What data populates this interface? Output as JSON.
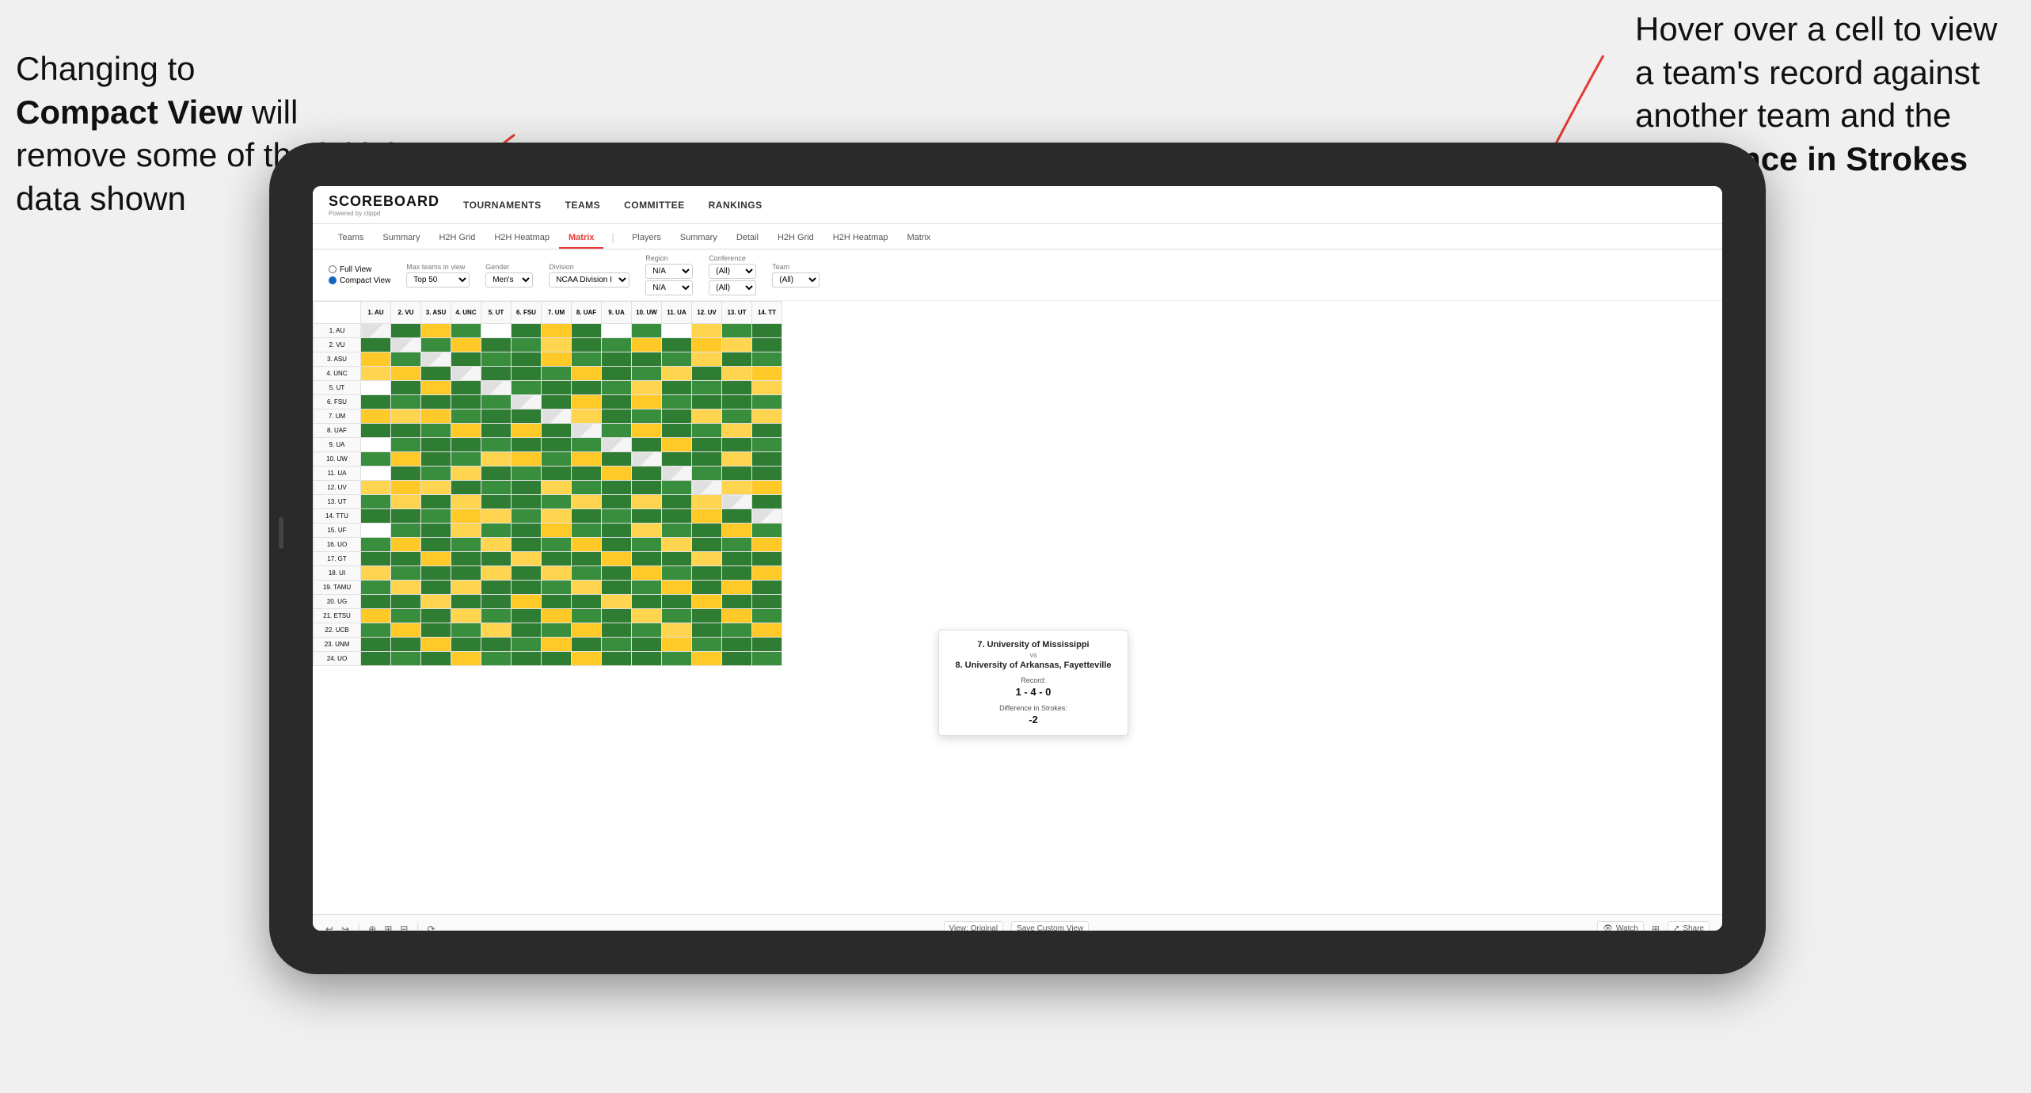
{
  "annotations": {
    "left_title": "Changing to",
    "left_bold": "Compact View",
    "left_text": " will remove some of the initial data shown",
    "right_text": "Hover over a cell to view a team's record against another team and the ",
    "right_bold": "Difference in Strokes"
  },
  "app": {
    "logo": "SCOREBOARD",
    "logo_sub": "Powered by clippd",
    "nav": [
      "TOURNAMENTS",
      "TEAMS",
      "COMMITTEE",
      "RANKINGS"
    ]
  },
  "sub_nav": {
    "groups": [
      {
        "label": "Teams"
      },
      {
        "label": "Summary"
      },
      {
        "label": "H2H Grid"
      },
      {
        "label": "H2H Heatmap"
      },
      {
        "label": "Matrix",
        "active": true
      }
    ],
    "groups2": [
      {
        "label": "Players"
      },
      {
        "label": "Summary"
      },
      {
        "label": "Detail"
      },
      {
        "label": "H2H Grid"
      },
      {
        "label": "H2H Heatmap"
      },
      {
        "label": "Matrix"
      }
    ]
  },
  "filters": {
    "view_full": "Full View",
    "view_compact": "Compact View",
    "max_teams_label": "Max teams in view",
    "max_teams_value": "Top 50",
    "gender_label": "Gender",
    "gender_value": "Men's",
    "division_label": "Division",
    "division_value": "NCAA Division I",
    "region_label": "Region",
    "region_value": "N/A",
    "region2_value": "N/A",
    "conference_label": "Conference",
    "conference_value": "(All)",
    "conference2_value": "(All)",
    "team_label": "Team",
    "team_value": "(All)"
  },
  "col_headers": [
    "1. AU",
    "2. VU",
    "3. ASU",
    "4. UNC",
    "5. UT",
    "6. FSU",
    "7. UM",
    "8. UAF",
    "9. UA",
    "10. UW",
    "11. UA",
    "12. UV",
    "13. UT",
    "14. TT"
  ],
  "row_headers": [
    "1. AU",
    "2. VU",
    "3. ASU",
    "4. UNC",
    "5. UT",
    "6. FSU",
    "7. UM",
    "8. UAF",
    "9. UA",
    "10. UW",
    "11. UA",
    "12. UV",
    "13. UT",
    "14. TTU",
    "15. UF",
    "16. UO",
    "17. GT",
    "18. UI",
    "19. TAMU",
    "20. UG",
    "21. ETSU",
    "22. UCB",
    "23. UNM",
    "24. UO"
  ],
  "tooltip": {
    "team1": "7. University of Mississippi",
    "vs": "vs",
    "team2": "8. University of Arkansas, Fayetteville",
    "record_label": "Record:",
    "record": "1 - 4 - 0",
    "diff_label": "Difference in Strokes:",
    "diff": "-2"
  },
  "toolbar": {
    "view_original": "View: Original",
    "save_custom": "Save Custom View",
    "watch": "Watch",
    "share": "Share"
  }
}
